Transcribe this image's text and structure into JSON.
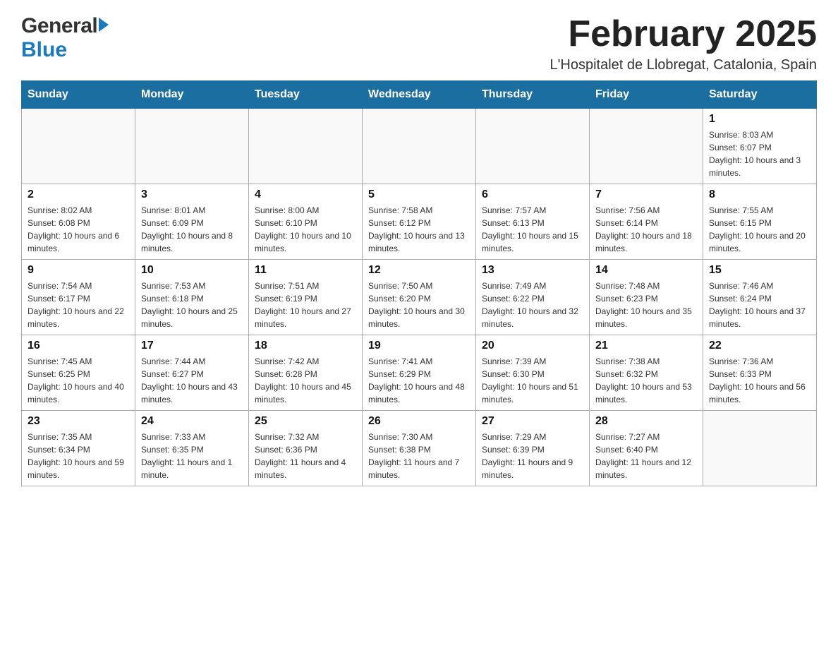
{
  "header": {
    "logo": {
      "general": "General",
      "blue": "Blue"
    },
    "title": "February 2025",
    "subtitle": "L'Hospitalet de Llobregat, Catalonia, Spain"
  },
  "calendar": {
    "days_of_week": [
      "Sunday",
      "Monday",
      "Tuesday",
      "Wednesday",
      "Thursday",
      "Friday",
      "Saturday"
    ],
    "weeks": [
      [
        {
          "day": "",
          "info": ""
        },
        {
          "day": "",
          "info": ""
        },
        {
          "day": "",
          "info": ""
        },
        {
          "day": "",
          "info": ""
        },
        {
          "day": "",
          "info": ""
        },
        {
          "day": "",
          "info": ""
        },
        {
          "day": "1",
          "info": "Sunrise: 8:03 AM\nSunset: 6:07 PM\nDaylight: 10 hours and 3 minutes."
        }
      ],
      [
        {
          "day": "2",
          "info": "Sunrise: 8:02 AM\nSunset: 6:08 PM\nDaylight: 10 hours and 6 minutes."
        },
        {
          "day": "3",
          "info": "Sunrise: 8:01 AM\nSunset: 6:09 PM\nDaylight: 10 hours and 8 minutes."
        },
        {
          "day": "4",
          "info": "Sunrise: 8:00 AM\nSunset: 6:10 PM\nDaylight: 10 hours and 10 minutes."
        },
        {
          "day": "5",
          "info": "Sunrise: 7:58 AM\nSunset: 6:12 PM\nDaylight: 10 hours and 13 minutes."
        },
        {
          "day": "6",
          "info": "Sunrise: 7:57 AM\nSunset: 6:13 PM\nDaylight: 10 hours and 15 minutes."
        },
        {
          "day": "7",
          "info": "Sunrise: 7:56 AM\nSunset: 6:14 PM\nDaylight: 10 hours and 18 minutes."
        },
        {
          "day": "8",
          "info": "Sunrise: 7:55 AM\nSunset: 6:15 PM\nDaylight: 10 hours and 20 minutes."
        }
      ],
      [
        {
          "day": "9",
          "info": "Sunrise: 7:54 AM\nSunset: 6:17 PM\nDaylight: 10 hours and 22 minutes."
        },
        {
          "day": "10",
          "info": "Sunrise: 7:53 AM\nSunset: 6:18 PM\nDaylight: 10 hours and 25 minutes."
        },
        {
          "day": "11",
          "info": "Sunrise: 7:51 AM\nSunset: 6:19 PM\nDaylight: 10 hours and 27 minutes."
        },
        {
          "day": "12",
          "info": "Sunrise: 7:50 AM\nSunset: 6:20 PM\nDaylight: 10 hours and 30 minutes."
        },
        {
          "day": "13",
          "info": "Sunrise: 7:49 AM\nSunset: 6:22 PM\nDaylight: 10 hours and 32 minutes."
        },
        {
          "day": "14",
          "info": "Sunrise: 7:48 AM\nSunset: 6:23 PM\nDaylight: 10 hours and 35 minutes."
        },
        {
          "day": "15",
          "info": "Sunrise: 7:46 AM\nSunset: 6:24 PM\nDaylight: 10 hours and 37 minutes."
        }
      ],
      [
        {
          "day": "16",
          "info": "Sunrise: 7:45 AM\nSunset: 6:25 PM\nDaylight: 10 hours and 40 minutes."
        },
        {
          "day": "17",
          "info": "Sunrise: 7:44 AM\nSunset: 6:27 PM\nDaylight: 10 hours and 43 minutes."
        },
        {
          "day": "18",
          "info": "Sunrise: 7:42 AM\nSunset: 6:28 PM\nDaylight: 10 hours and 45 minutes."
        },
        {
          "day": "19",
          "info": "Sunrise: 7:41 AM\nSunset: 6:29 PM\nDaylight: 10 hours and 48 minutes."
        },
        {
          "day": "20",
          "info": "Sunrise: 7:39 AM\nSunset: 6:30 PM\nDaylight: 10 hours and 51 minutes."
        },
        {
          "day": "21",
          "info": "Sunrise: 7:38 AM\nSunset: 6:32 PM\nDaylight: 10 hours and 53 minutes."
        },
        {
          "day": "22",
          "info": "Sunrise: 7:36 AM\nSunset: 6:33 PM\nDaylight: 10 hours and 56 minutes."
        }
      ],
      [
        {
          "day": "23",
          "info": "Sunrise: 7:35 AM\nSunset: 6:34 PM\nDaylight: 10 hours and 59 minutes."
        },
        {
          "day": "24",
          "info": "Sunrise: 7:33 AM\nSunset: 6:35 PM\nDaylight: 11 hours and 1 minute."
        },
        {
          "day": "25",
          "info": "Sunrise: 7:32 AM\nSunset: 6:36 PM\nDaylight: 11 hours and 4 minutes."
        },
        {
          "day": "26",
          "info": "Sunrise: 7:30 AM\nSunset: 6:38 PM\nDaylight: 11 hours and 7 minutes."
        },
        {
          "day": "27",
          "info": "Sunrise: 7:29 AM\nSunset: 6:39 PM\nDaylight: 11 hours and 9 minutes."
        },
        {
          "day": "28",
          "info": "Sunrise: 7:27 AM\nSunset: 6:40 PM\nDaylight: 11 hours and 12 minutes."
        },
        {
          "day": "",
          "info": ""
        }
      ]
    ]
  }
}
